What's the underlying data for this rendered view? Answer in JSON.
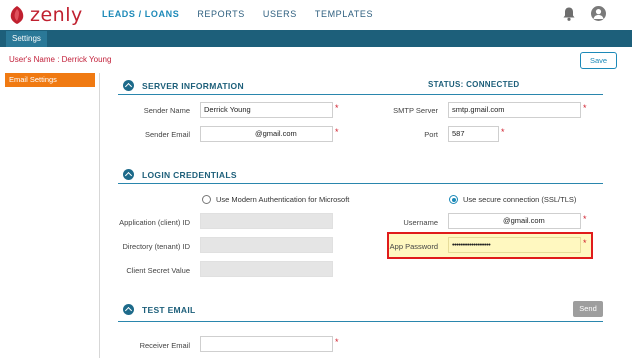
{
  "brand": {
    "name": "zenly"
  },
  "nav": {
    "items": [
      "LEADS / LOANS",
      "REPORTS",
      "USERS",
      "TEMPLATES"
    ],
    "active": "LEADS / LOANS"
  },
  "subnav": {
    "tab": "Settings"
  },
  "page": {
    "username": "User's Name : Derrick Young",
    "save_label": "Save"
  },
  "sidebar": {
    "items": [
      {
        "label": "Email Settings",
        "active": true
      }
    ]
  },
  "server": {
    "title": "SERVER INFORMATION",
    "status": "STATUS: CONNECTED",
    "sender_name_label": "Sender Name",
    "sender_name_value": "Derrick Young",
    "sender_email_label": "Sender Email",
    "sender_email_value": "@gmail.com",
    "smtp_label": "SMTP Server",
    "smtp_value": "smtp.gmail.com",
    "port_label": "Port",
    "port_value": "587"
  },
  "login": {
    "title": "LOGIN CREDENTIALS",
    "option_modern": "Use Modern Authentication for Microsoft",
    "option_ssl": "Use secure connection (SSL/TLS)",
    "selected_option": "ssl",
    "app_id_label": "Application (client) ID",
    "dir_id_label": "Directory (tenant) ID",
    "secret_label": "Client Secret Value",
    "username_label": "Username",
    "username_value": "@gmail.com",
    "app_password_label": "App Password",
    "app_password_value": "••••••••••••••••••"
  },
  "test": {
    "title": "TEST EMAIL",
    "send_label": "Send",
    "receiver_label": "Receiver Email",
    "receiver_value": ""
  },
  "colors": {
    "brand": "#c0202f",
    "primary": "#1d5f7a",
    "accent": "#1c89b8",
    "sidebar_active": "#f07a12",
    "required": "#d0202e",
    "highlight_border": "#e01b1b"
  }
}
